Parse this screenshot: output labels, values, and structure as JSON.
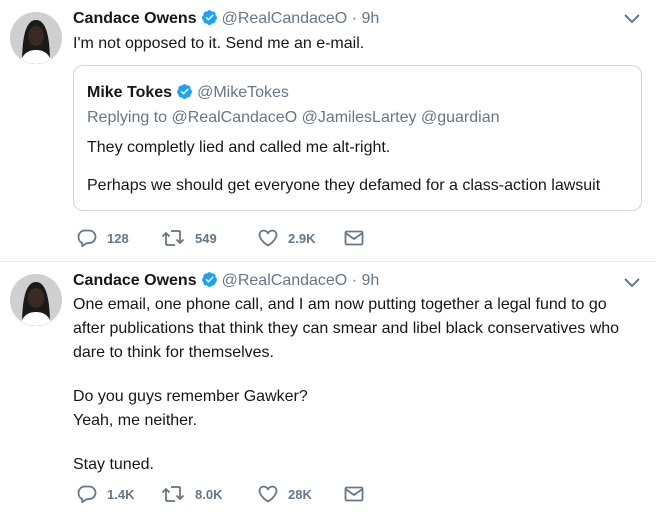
{
  "tweets": [
    {
      "author_name": "Candace Owens",
      "handle": "@RealCandaceO",
      "separator": "·",
      "time": "9h",
      "text": [
        "I'm not opposed to it. Send me an e-mail."
      ],
      "quoted": {
        "author_name": "Mike Tokes",
        "handle": "@MikeTokes",
        "replying_to": "Replying to @RealCandaceO @JamilesLartey @guardian",
        "text": [
          "They completly lied and called me alt-right.",
          "Perhaps we should get everyone they defamed for a class-action lawsuit"
        ]
      },
      "actions": {
        "replies": "128",
        "retweets": "549",
        "likes": "2.9K"
      }
    },
    {
      "author_name": "Candace Owens",
      "handle": "@RealCandaceO",
      "separator": "·",
      "time": "9h",
      "text": [
        "One email, one phone call, and I am now putting together a legal fund to go after publications that think they can smear and libel black conservatives who dare to think for themselves.",
        "Do you guys remember Gawker?\nYeah, me neither.",
        "Stay tuned."
      ],
      "actions": {
        "replies": "1.4K",
        "retweets": "8.0K",
        "likes": "28K"
      }
    }
  ],
  "icons": {
    "verified": "verified-badge-icon",
    "caret": "chevron-down-icon",
    "reply": "reply-icon",
    "retweet": "retweet-icon",
    "like": "heart-icon",
    "message": "envelope-icon"
  },
  "colors": {
    "verified_blue": "#1da1f2",
    "secondary_text": "#657786",
    "border": "#e6ecf0"
  }
}
